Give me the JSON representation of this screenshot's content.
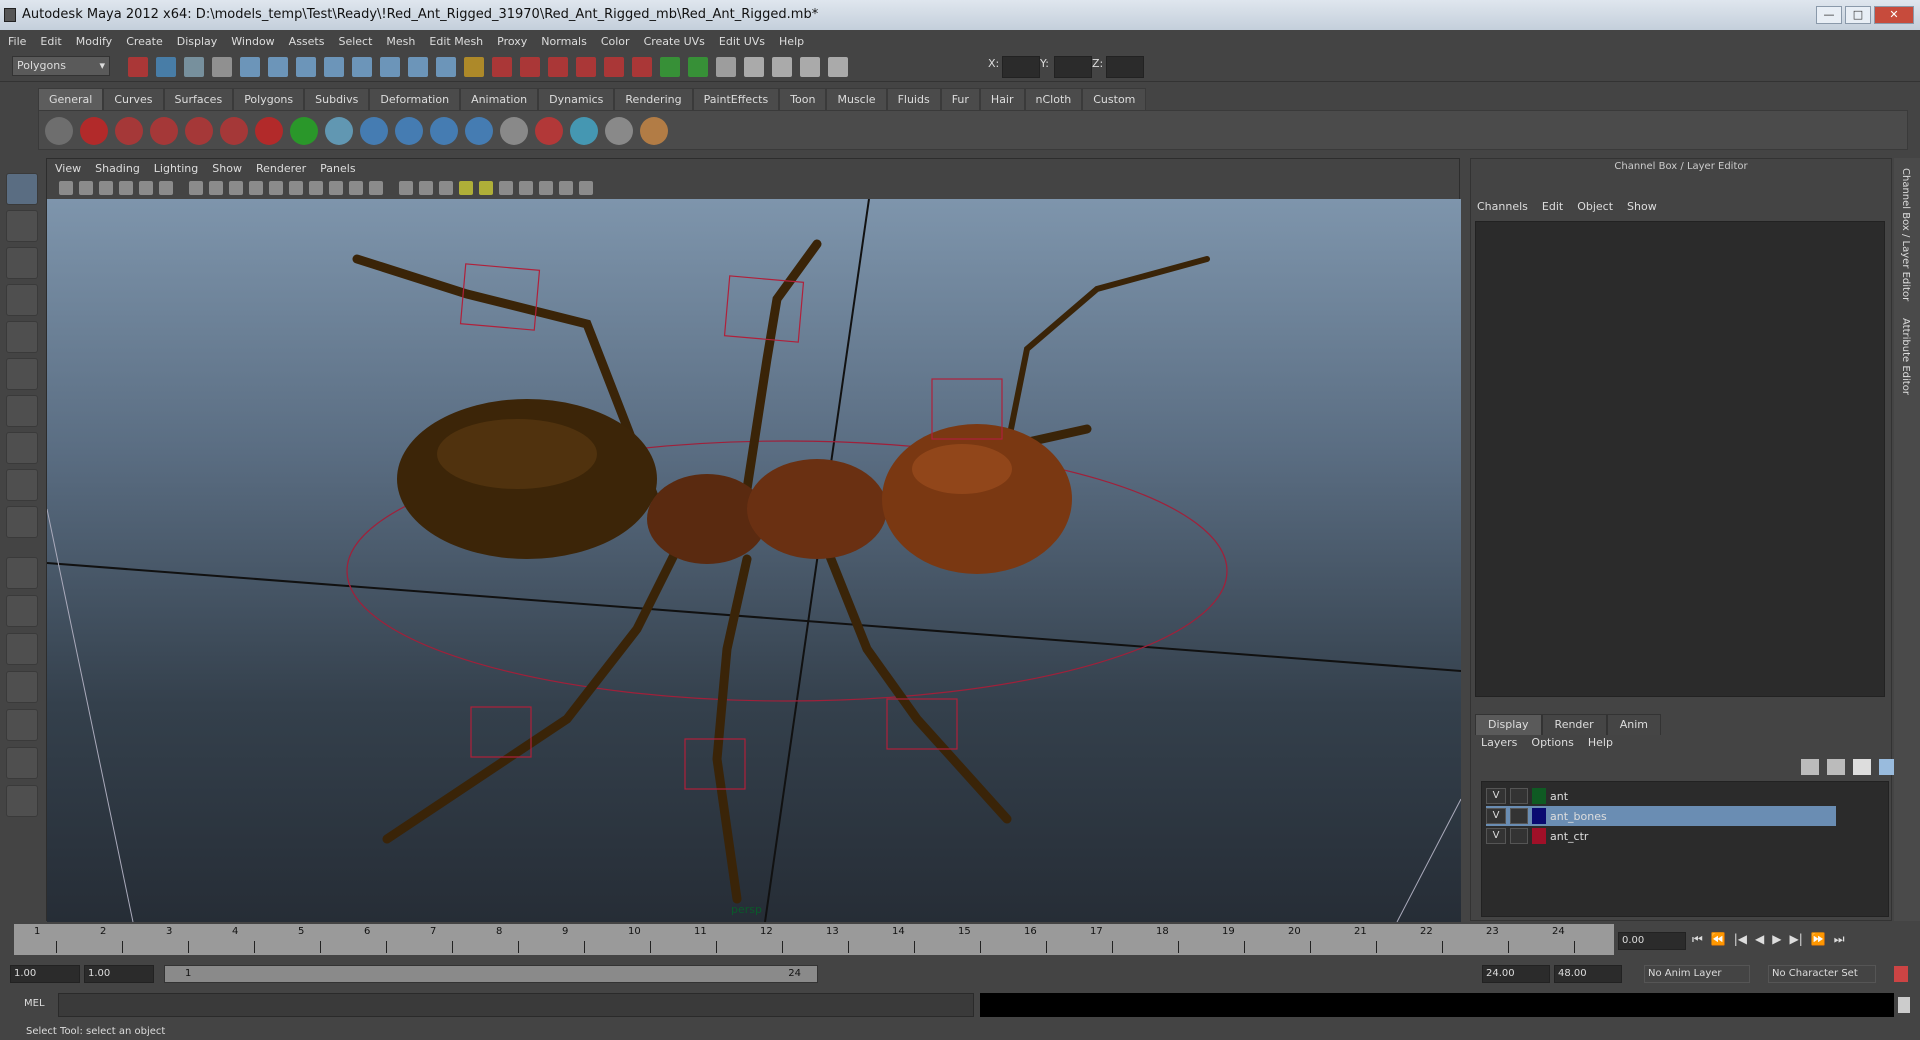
{
  "window": {
    "title": "Autodesk Maya 2012 x64: D:\\models_temp\\Test\\Ready\\!Red_Ant_Rigged_31970\\Red_Ant_Rigged_mb\\Red_Ant_Rigged.mb*",
    "min": "—",
    "max": "□",
    "close": "✕"
  },
  "menu": [
    "File",
    "Edit",
    "Modify",
    "Create",
    "Display",
    "Window",
    "Assets",
    "Select",
    "Mesh",
    "Edit Mesh",
    "Proxy",
    "Normals",
    "Color",
    "Create UVs",
    "Edit UVs",
    "Help"
  ],
  "statusline": {
    "mode": "Polygons",
    "x_label": "X:",
    "y_label": "Y:",
    "z_label": "Z:"
  },
  "shelf_tabs": [
    "General",
    "Curves",
    "Surfaces",
    "Polygons",
    "Subdivs",
    "Deformation",
    "Animation",
    "Dynamics",
    "Rendering",
    "PaintEffects",
    "Toon",
    "Muscle",
    "Fluids",
    "Fur",
    "Hair",
    "nCloth",
    "Custom"
  ],
  "viewport": {
    "menu": [
      "View",
      "Shading",
      "Lighting",
      "Show",
      "Renderer",
      "Panels"
    ],
    "camera": "persp"
  },
  "channel_box": {
    "title": "Channel Box / Layer Editor",
    "menu": [
      "Channels",
      "Edit",
      "Object",
      "Show"
    ]
  },
  "layer_editor": {
    "tabs": [
      "Display",
      "Render",
      "Anim"
    ],
    "menu": [
      "Layers",
      "Options",
      "Help"
    ],
    "layers": [
      {
        "v": "V",
        "name": "ant",
        "color": "#0f5a23",
        "selected": false
      },
      {
        "v": "V",
        "name": "ant_bones",
        "color": "#0a0a70",
        "selected": true
      },
      {
        "v": "V",
        "name": "ant_ctr",
        "color": "#a01028",
        "selected": false
      }
    ]
  },
  "side_tabs": [
    "Channel Box / Layer Editor",
    "Attribute Editor"
  ],
  "timeline": {
    "ticks": [
      "1",
      "2",
      "3",
      "4",
      "5",
      "6",
      "7",
      "8",
      "9",
      "10",
      "11",
      "12",
      "13",
      "14",
      "15",
      "16",
      "17",
      "18",
      "19",
      "20",
      "21",
      "22",
      "23",
      "24"
    ],
    "current_time": "0.00"
  },
  "range": {
    "start": "1.00",
    "playback_start": "1.00",
    "slider_start": "1",
    "slider_end": "24",
    "playback_end": "24.00",
    "end": "48.00",
    "anim_layer": "No Anim Layer",
    "char_set": "No Character Set"
  },
  "command": {
    "label": "MEL"
  },
  "status": "Select Tool: select an object"
}
